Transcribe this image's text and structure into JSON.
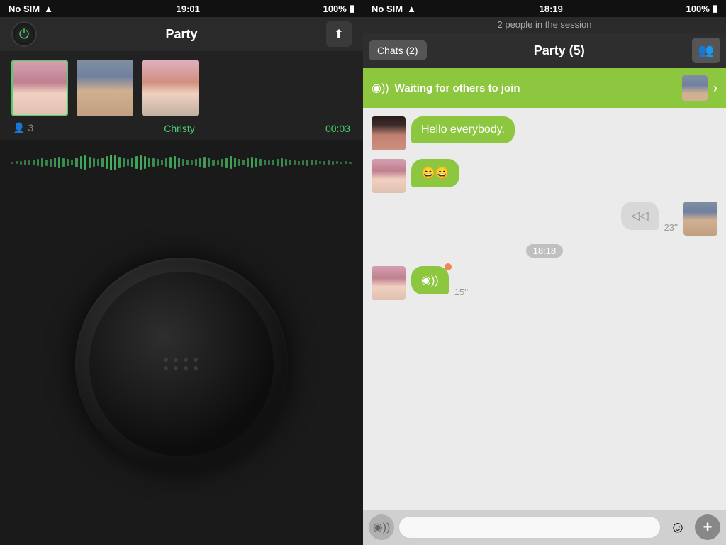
{
  "left": {
    "statusBar": {
      "carrier": "No SIM",
      "time": "19:01",
      "battery": "100%"
    },
    "titleBar": {
      "title": "Party",
      "powerLabel": "⏻",
      "uploadLabel": "⬆"
    },
    "participants": {
      "count": "3",
      "countIcon": "👤",
      "activeName": "Christy",
      "timer": "00:03"
    },
    "dialDots": [
      1,
      2,
      3,
      4,
      5,
      6,
      7,
      8
    ]
  },
  "right": {
    "statusBar": {
      "carrier": "No SIM",
      "time": "18:19",
      "battery": "100%"
    },
    "sessionInfo": "2 people in the session",
    "navBar": {
      "chatsLabel": "Chats (2)",
      "partyTitle": "Party  (5)"
    },
    "waitingBanner": {
      "text": "Waiting for others to join"
    },
    "messages": [
      {
        "id": 1,
        "side": "left",
        "face": "face1",
        "text": "Hello everybody.",
        "type": "text"
      },
      {
        "id": 2,
        "side": "left",
        "face": "face2",
        "text": "😄😄",
        "type": "emoji"
      },
      {
        "id": 3,
        "side": "right",
        "face": "face3",
        "timestamp": "23''",
        "type": "voice"
      },
      {
        "id": 4,
        "timestamp": "18:18",
        "type": "timestamp-center"
      },
      {
        "id": 5,
        "side": "left",
        "face": "face4",
        "timestamp": "15''",
        "type": "voice-left",
        "recording": true
      }
    ],
    "inputBar": {
      "placeholder": "",
      "voiceIcon": "◉",
      "emojiIcon": "☺",
      "addIcon": "+"
    }
  }
}
